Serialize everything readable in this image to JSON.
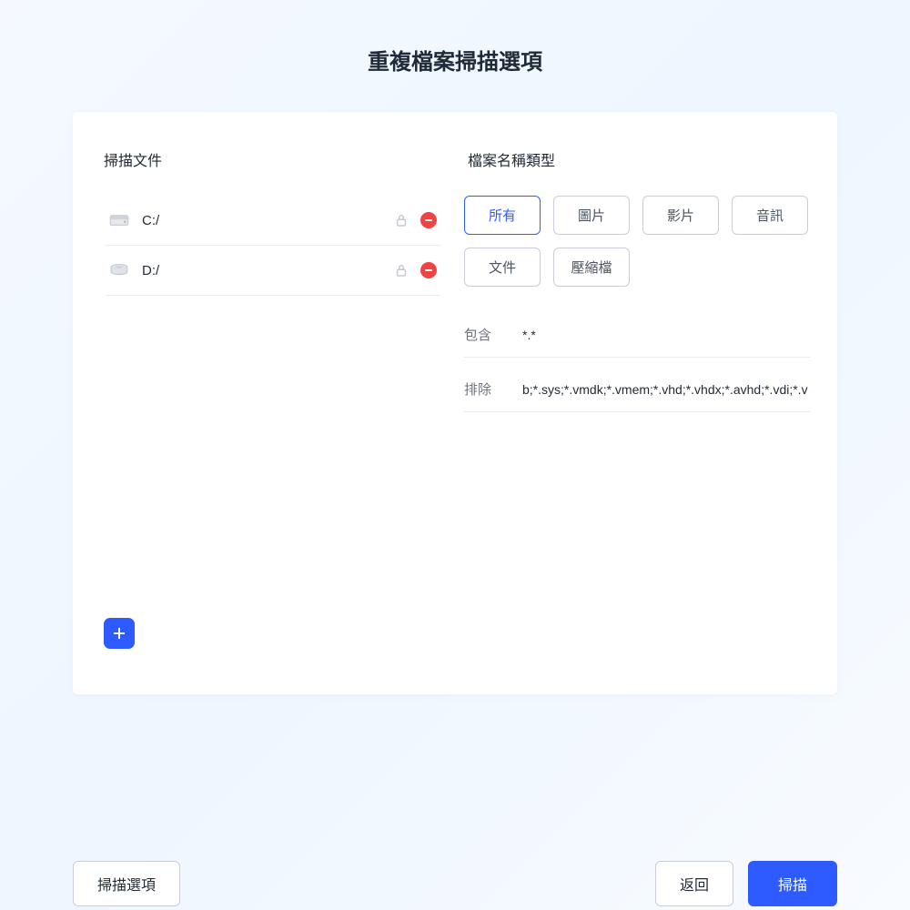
{
  "title": "重複檔案掃描選項",
  "left": {
    "heading": "掃描文件",
    "drives": [
      {
        "label": "C:/"
      },
      {
        "label": "D:/"
      }
    ]
  },
  "right": {
    "heading": "檔案名稱類型",
    "types": {
      "all": "所有",
      "image": "圖片",
      "video": "影片",
      "audio": "音訊",
      "doc": "文件",
      "archive": "壓縮檔"
    },
    "include_label": "包含",
    "include_value": "*.*",
    "exclude_label": "排除",
    "exclude_value": "b;*.sys;*.vmdk;*.vmem;*.vhd;*.vhdx;*.avhd;*.vdi;*.vbox;*.sav;"
  },
  "footer": {
    "options": "掃描選項",
    "back": "返回",
    "scan": "掃描"
  }
}
